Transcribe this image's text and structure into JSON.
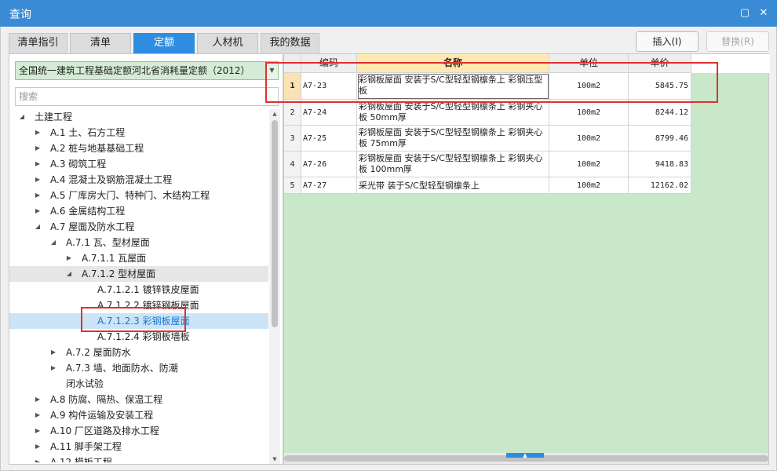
{
  "window": {
    "title": "查询"
  },
  "tabs": [
    {
      "label": "清单指引",
      "active": false
    },
    {
      "label": "清单",
      "active": false
    },
    {
      "label": "定额",
      "active": true
    },
    {
      "label": "人材机",
      "active": false
    },
    {
      "label": "我的数据",
      "active": false
    }
  ],
  "actions": {
    "insert": "插入(I)",
    "replace": "替换(R)"
  },
  "quota_selector": {
    "value": "全国统一建筑工程基础定额河北省消耗量定额（2012）"
  },
  "search": {
    "placeholder": "搜索"
  },
  "tree": [
    {
      "label": "土建工程",
      "level": 0,
      "state": "expanded"
    },
    {
      "label": "A.1 土、石方工程",
      "level": 1,
      "state": "collapsed"
    },
    {
      "label": "A.2 桩与地基基础工程",
      "level": 1,
      "state": "collapsed"
    },
    {
      "label": "A.3 砌筑工程",
      "level": 1,
      "state": "collapsed"
    },
    {
      "label": "A.4 混凝土及钢筋混凝土工程",
      "level": 1,
      "state": "collapsed"
    },
    {
      "label": "A.5 厂库房大门、特种门、木结构工程",
      "level": 1,
      "state": "collapsed"
    },
    {
      "label": "A.6 金属结构工程",
      "level": 1,
      "state": "collapsed"
    },
    {
      "label": "A.7 屋面及防水工程",
      "level": 1,
      "state": "expanded"
    },
    {
      "label": "A.7.1 瓦、型材屋面",
      "level": 2,
      "state": "expanded"
    },
    {
      "label": "A.7.1.1 瓦屋面",
      "level": 3,
      "state": "collapsed"
    },
    {
      "label": "A.7.1.2 型材屋面",
      "level": 3,
      "state": "expanded",
      "highlight": true
    },
    {
      "label": "A.7.1.2.1 镀锌铁皮屋面",
      "level": 4,
      "state": "leaf"
    },
    {
      "label": "A.7.1.2.2 镀锌钢板屋面",
      "level": 4,
      "state": "leaf"
    },
    {
      "label": "A.7.1.2.3 彩钢板屋面",
      "level": 4,
      "state": "leaf",
      "selected": true
    },
    {
      "label": "A.7.1.2.4 彩钢板墙板",
      "level": 4,
      "state": "leaf"
    },
    {
      "label": "A.7.2 屋面防水",
      "level": 2,
      "state": "collapsed"
    },
    {
      "label": "A.7.3 墙、地面防水、防潮",
      "level": 2,
      "state": "collapsed"
    },
    {
      "label": "闭水试验",
      "level": 2,
      "state": "leaf"
    },
    {
      "label": "A.8 防腐、隔热、保温工程",
      "level": 1,
      "state": "collapsed"
    },
    {
      "label": "A.9 构件运输及安装工程",
      "level": 1,
      "state": "collapsed"
    },
    {
      "label": "A.10 厂区道路及排水工程",
      "level": 1,
      "state": "collapsed"
    },
    {
      "label": "A.11 脚手架工程",
      "level": 1,
      "state": "collapsed"
    },
    {
      "label": "A.12 模板工程",
      "level": 1,
      "state": "collapsed"
    }
  ],
  "grid": {
    "columns": [
      "编码",
      "名称",
      "单位",
      "单价"
    ],
    "rows": [
      {
        "num": "1",
        "code": "A7-23",
        "name": "彩钢板屋面 安装于S/C型轻型钢檩条上 彩钢压型板",
        "unit": "100m2",
        "price": "5845.75"
      },
      {
        "num": "2",
        "code": "A7-24",
        "name": "彩钢板屋面 安装于S/C型轻型钢檩条上 彩钢夹心板 50mm厚",
        "unit": "100m2",
        "price": "8244.12"
      },
      {
        "num": "3",
        "code": "A7-25",
        "name": "彩钢板屋面 安装于S/C型轻型钢檩条上 彩钢夹心板 75mm厚",
        "unit": "100m2",
        "price": "8799.46"
      },
      {
        "num": "4",
        "code": "A7-26",
        "name": "彩钢板屋面 安装于S/C型轻型钢檩条上 彩钢夹心板 100mm厚",
        "unit": "100m2",
        "price": "9418.83"
      },
      {
        "num": "5",
        "code": "A7-27",
        "name": "采光带 装于S/C型轻型钢檩条上",
        "unit": "100m2",
        "price": "12162.02"
      }
    ]
  },
  "colors": {
    "titlebar": "#3a8bd5",
    "tab_active": "#2e8de0",
    "grid_bg": "#c9e8c9",
    "highlight_box": "#e03030"
  }
}
